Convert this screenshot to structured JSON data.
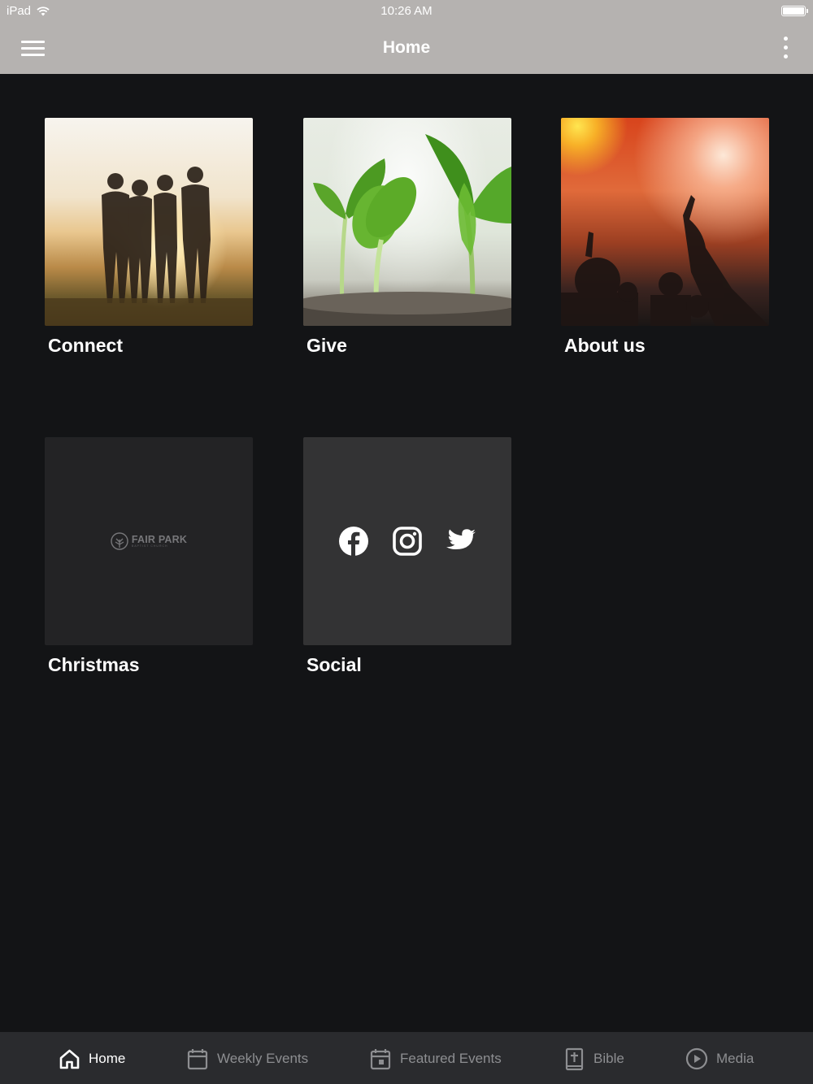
{
  "status_bar": {
    "device": "iPad",
    "time": "10:26 AM"
  },
  "header": {
    "title": "Home"
  },
  "tiles": [
    {
      "label": "Connect"
    },
    {
      "label": "Give"
    },
    {
      "label": "About us"
    },
    {
      "label": "Christmas",
      "logo_text": "FAIR PARK",
      "logo_subtext": "BAPTIST CHURCH"
    },
    {
      "label": "Social",
      "icons": [
        "facebook-icon",
        "instagram-icon",
        "twitter-icon"
      ]
    }
  ],
  "tabs": [
    {
      "label": "Home",
      "icon": "home-icon",
      "active": true
    },
    {
      "label": "Weekly Events",
      "icon": "calendar-icon",
      "active": false
    },
    {
      "label": "Featured Events",
      "icon": "calendar-event-icon",
      "active": false
    },
    {
      "label": "Bible",
      "icon": "bible-icon",
      "active": false
    },
    {
      "label": "Media",
      "icon": "play-circle-icon",
      "active": false
    }
  ],
  "colors": {
    "header_bg": "#b5b2b0",
    "page_bg": "#131416",
    "tabbar_bg": "#2a2b2e",
    "tab_inactive": "#8d8e91",
    "tab_active": "#ffffff"
  }
}
